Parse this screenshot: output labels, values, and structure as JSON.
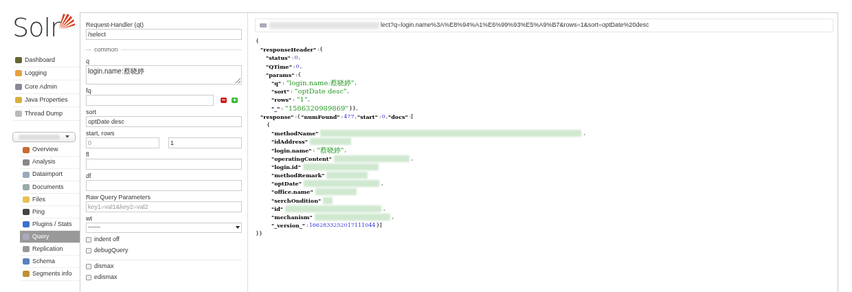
{
  "logo": {
    "text": "Solr"
  },
  "nav": [
    {
      "label": "Dashboard",
      "selected": false
    },
    {
      "label": "Logging",
      "selected": false
    },
    {
      "label": "Core Admin",
      "selected": false
    },
    {
      "label": "Java Properties",
      "selected": false
    },
    {
      "label": "Thread Dump",
      "selected": false
    }
  ],
  "core_nav": [
    {
      "label": "Overview",
      "selected": false
    },
    {
      "label": "Analysis",
      "selected": false
    },
    {
      "label": "Dataimport",
      "selected": false
    },
    {
      "label": "Documents",
      "selected": false
    },
    {
      "label": "Files",
      "selected": false
    },
    {
      "label": "Ping",
      "selected": false
    },
    {
      "label": "Plugins / Stats",
      "selected": false
    },
    {
      "label": "Query",
      "selected": true
    },
    {
      "label": "Replication",
      "selected": false
    },
    {
      "label": "Schema",
      "selected": false
    },
    {
      "label": "Segments info",
      "selected": false
    }
  ],
  "form": [
    {
      "kind": "text",
      "label": "Request-Handler (qt)",
      "value": "/select"
    },
    {
      "kind": "legend",
      "label": "common"
    },
    {
      "kind": "textarea",
      "label": "q",
      "value": "login.name:蔡晓婷"
    },
    {
      "kind": "fq",
      "label": "fq"
    },
    {
      "kind": "text",
      "label": "sort",
      "value": "optDate desc"
    },
    {
      "kind": "pair",
      "label": "start, rows",
      "placeholder": "0",
      "value": "1"
    },
    {
      "kind": "text",
      "label": "fl"
    },
    {
      "kind": "text",
      "label": "df"
    },
    {
      "kind": "text",
      "label": "Raw Query Parameters",
      "placeholder": "key1=val1&key2=val2"
    },
    {
      "kind": "select",
      "label": "wt",
      "value": "------"
    },
    {
      "kind": "checkbox",
      "label": "indent off",
      "checked": false
    },
    {
      "kind": "checkbox",
      "label": "debugQuery",
      "checked": false
    },
    {
      "kind": "divider"
    },
    {
      "kind": "checkbox",
      "label": "dismax",
      "checked": false
    },
    {
      "kind": "checkbox",
      "label": "edismax",
      "checked": false
    }
  ],
  "url": {
    "text": "lect?q=login.name%3A%E8%94%A1%E6%99%93%E5%A9%B7&rows=1&sort=optDate%20desc"
  },
  "response": [
    {
      "t": [
        {
          "kind": "punct",
          "text": "{"
        }
      ],
      "children": [
        {
          "t": [
            {
              "kind": "key",
              "text": "\"responseHeader\""
            },
            {
              "kind": "punct",
              "text": ":{"
            }
          ],
          "children": [
            {
              "t": [
                {
                  "kind": "key",
                  "text": "\"status\""
                },
                {
                  "kind": "punct",
                  "text": ":"
                },
                {
                  "kind": "number",
                  "text": "0"
                },
                {
                  "kind": "punct",
                  "text": ","
                }
              ]
            },
            {
              "t": [
                {
                  "kind": "key",
                  "text": "\"QTime\""
                },
                {
                  "kind": "punct",
                  "text": ":"
                },
                {
                  "kind": "number",
                  "text": "0"
                },
                {
                  "kind": "punct",
                  "text": ","
                }
              ]
            },
            {
              "t": [
                {
                  "kind": "key",
                  "text": "\"params\""
                },
                {
                  "kind": "punct",
                  "text": ":{"
                }
              ],
              "children": [
                {
                  "t": [
                    {
                      "kind": "key",
                      "text": "\"q\""
                    },
                    {
                      "kind": "punct",
                      "text": ":"
                    },
                    {
                      "kind": "string",
                      "text": "\"login.name:蔡晓婷\""
                    },
                    {
                      "kind": "punct",
                      "text": ","
                    }
                  ]
                },
                {
                  "t": [
                    {
                      "kind": "key",
                      "text": "\"sort\""
                    },
                    {
                      "kind": "punct",
                      "text": ":"
                    },
                    {
                      "kind": "string",
                      "text": "\"optDate desc\""
                    },
                    {
                      "kind": "punct",
                      "text": ","
                    }
                  ]
                },
                {
                  "t": [
                    {
                      "kind": "key",
                      "text": "\"rows\""
                    },
                    {
                      "kind": "punct",
                      "text": ":"
                    },
                    {
                      "kind": "string",
                      "text": "\"1\""
                    },
                    {
                      "kind": "punct",
                      "text": ","
                    }
                  ]
                },
                {
                  "t": [
                    {
                      "kind": "key",
                      "text": "\"_\""
                    },
                    {
                      "kind": "punct",
                      "text": ":"
                    },
                    {
                      "kind": "string",
                      "text": "\"1586320989869\""
                    },
                    {
                      "kind": "punct",
                      "text": "}},"
                    }
                  ]
                }
              ]
            }
          ]
        },
        {
          "t": [
            {
              "kind": "key",
              "text": "\"response\""
            },
            {
              "kind": "punct",
              "text": ":{"
            },
            {
              "kind": "key",
              "text": "\"numFound\""
            },
            {
              "kind": "punct",
              "text": ":"
            },
            {
              "kind": "number",
              "text": "477"
            },
            {
              "kind": "punct",
              "text": ","
            },
            {
              "kind": "key",
              "text": "\"start\""
            },
            {
              "kind": "punct",
              "text": ":"
            },
            {
              "kind": "number",
              "text": "0"
            },
            {
              "kind": "punct",
              "text": ","
            },
            {
              "kind": "key",
              "text": "\"docs\""
            },
            {
              "kind": "punct",
              "text": ":["
            }
          ],
          "children": [
            {
              "t": [
                {
                  "kind": "punct",
                  "text": "{"
                }
              ],
              "children": [
                {
                  "t": [
                    {
                      "kind": "key",
                      "text": "\"methodName\""
                    },
                    {
                      "kind": "redacted"
                    },
                    {
                      "kind": "punct",
                      "text": ","
                    }
                  ]
                },
                {
                  "t": [
                    {
                      "kind": "key",
                      "text": "\"idAddress\""
                    },
                    {
                      "kind": "redacted"
                    }
                  ]
                },
                {
                  "t": [
                    {
                      "kind": "key",
                      "text": "\"login.name\""
                    },
                    {
                      "kind": "punct",
                      "text": ":"
                    },
                    {
                      "kind": "string",
                      "text": "\"蔡晓婷\""
                    },
                    {
                      "kind": "punct",
                      "text": ","
                    }
                  ]
                },
                {
                  "t": [
                    {
                      "kind": "key",
                      "text": "\"operatingContent\""
                    },
                    {
                      "kind": "redacted"
                    },
                    {
                      "kind": "punct",
                      "text": ","
                    }
                  ]
                },
                {
                  "t": [
                    {
                      "kind": "key",
                      "text": "\"login.id\""
                    },
                    {
                      "kind": "redacted"
                    }
                  ]
                },
                {
                  "t": [
                    {
                      "kind": "key",
                      "text": "\"methodRemark\""
                    },
                    {
                      "kind": "redacted"
                    }
                  ]
                },
                {
                  "t": [
                    {
                      "kind": "key",
                      "text": "\"optDate\""
                    },
                    {
                      "kind": "redacted"
                    },
                    {
                      "kind": "punct",
                      "text": ","
                    }
                  ]
                },
                {
                  "t": [
                    {
                      "kind": "key",
                      "text": "\"office.name\""
                    },
                    {
                      "kind": "redacted"
                    }
                  ]
                },
                {
                  "t": [
                    {
                      "kind": "key",
                      "text": "\"serchOndition\""
                    },
                    {
                      "kind": "redacted"
                    }
                  ]
                },
                {
                  "t": [
                    {
                      "kind": "key",
                      "text": "\"id\""
                    },
                    {
                      "kind": "redacted"
                    },
                    {
                      "kind": "punct",
                      "text": ","
                    }
                  ]
                },
                {
                  "t": [
                    {
                      "kind": "key",
                      "text": "\"mechanism\""
                    },
                    {
                      "kind": "redacted"
                    },
                    {
                      "kind": "punct",
                      "text": ","
                    }
                  ]
                },
                {
                  "t": [
                    {
                      "kind": "key",
                      "text": "\"_version_\""
                    },
                    {
                      "kind": "punct",
                      "text": ":"
                    },
                    {
                      "kind": "number",
                      "text": "1662833252017111044"
                    },
                    {
                      "kind": "punct",
                      "text": "}]"
                    }
                  ]
                }
              ]
            }
          ]
        }
      ]
    },
    {
      "t": [
        {
          "kind": "punct",
          "text": "}}"
        }
      ]
    }
  ]
}
